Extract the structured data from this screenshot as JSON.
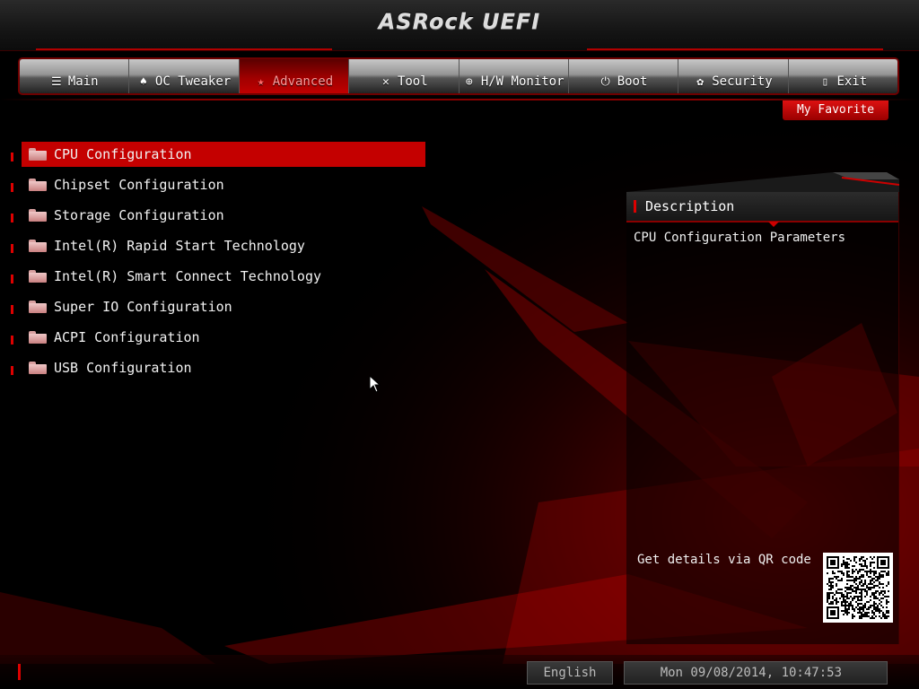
{
  "header": {
    "logo": "ASRock UEFI"
  },
  "tabs": [
    {
      "label": "Main",
      "icon": "list-icon",
      "glyph": "☰",
      "active": false
    },
    {
      "label": "OC Tweaker",
      "icon": "rocket-icon",
      "glyph": "♠",
      "active": false
    },
    {
      "label": "Advanced",
      "icon": "star-icon",
      "glyph": "★",
      "active": true
    },
    {
      "label": "Tool",
      "icon": "tools-icon",
      "glyph": "✕",
      "active": false
    },
    {
      "label": "H/W Monitor",
      "icon": "monitor-icon",
      "glyph": "⊕",
      "active": false
    },
    {
      "label": "Boot",
      "icon": "power-icon",
      "glyph": "⏻",
      "active": false
    },
    {
      "label": "Security",
      "icon": "shield-icon",
      "glyph": "✿",
      "active": false
    },
    {
      "label": "Exit",
      "icon": "door-icon",
      "glyph": "▯",
      "active": false
    }
  ],
  "favorite_button": "My Favorite",
  "menu": {
    "items": [
      {
        "label": "CPU Configuration",
        "selected": true
      },
      {
        "label": "Chipset Configuration",
        "selected": false
      },
      {
        "label": "Storage Configuration",
        "selected": false
      },
      {
        "label": "Intel(R) Rapid Start Technology",
        "selected": false
      },
      {
        "label": "Intel(R) Smart Connect Technology",
        "selected": false
      },
      {
        "label": "Super IO Configuration",
        "selected": false
      },
      {
        "label": "ACPI Configuration",
        "selected": false
      },
      {
        "label": "USB Configuration",
        "selected": false
      }
    ]
  },
  "description": {
    "title": "Description",
    "text": "CPU Configuration Parameters",
    "qr_label": "Get details via QR code"
  },
  "footer": {
    "language": "English",
    "datetime": "Mon 09/08/2014, 10:47:53"
  },
  "colors": {
    "accent": "#c40000",
    "background": "#000000"
  }
}
